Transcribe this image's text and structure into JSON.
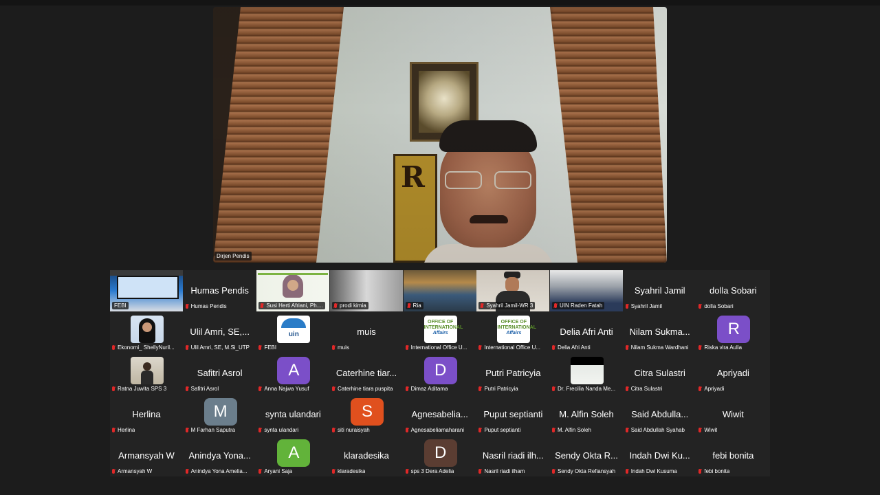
{
  "speaker": {
    "name": "Dirjen Pendis",
    "wall_letter": "R"
  },
  "colors": {
    "background": "#1c1c1c",
    "tile_bg": "#232323",
    "muted_mic": "#e02828",
    "avatar_purple": "#7b4fc8",
    "avatar_gray": "#6b7e8c",
    "avatar_green": "#62b33a",
    "avatar_orange": "#e0501e",
    "avatar_brown": "#5b3d32"
  },
  "participants": [
    {
      "big": "",
      "label": "FEBI",
      "kind": "video-blue",
      "muted": false
    },
    {
      "big": "Humas Pendis",
      "label": "Humas Pendis",
      "kind": "text",
      "muted": true
    },
    {
      "big": "",
      "label": "Susi Herti Afriani, Ph....",
      "kind": "video-woman",
      "muted": true
    },
    {
      "big": "",
      "label": "prodi kimia",
      "kind": "video-gray",
      "muted": true
    },
    {
      "big": "",
      "label": "Ria",
      "kind": "video-hall",
      "muted": true
    },
    {
      "big": "",
      "label": "Syahril Jamil-WR 3",
      "kind": "video-man",
      "muted": true
    },
    {
      "big": "",
      "label": "UIN Raden Fatah",
      "kind": "video-hall2",
      "muted": true
    },
    {
      "big": "Syahril Jamil",
      "label": "Syahril Jamil",
      "kind": "text",
      "muted": true
    },
    {
      "big": "dolla Sobari",
      "label": "dolla Sobari",
      "kind": "text",
      "muted": true
    },
    {
      "big": "",
      "label": "Ekonomi_ ShellyNuril...",
      "kind": "photo-hijab",
      "muted": true
    },
    {
      "big": "Ulil Amri, SE,...",
      "label": "Ulil Amri, SE, M.Si_UTP",
      "kind": "text",
      "muted": true
    },
    {
      "big": "",
      "label": "FEBI",
      "kind": "logo-uin",
      "muted": true
    },
    {
      "big": "muis",
      "label": "muis",
      "kind": "text",
      "muted": true
    },
    {
      "big": "",
      "label": "International Office U...",
      "kind": "logo-oia",
      "muted": true
    },
    {
      "big": "",
      "label": "International Office U...",
      "kind": "logo-oia",
      "muted": true
    },
    {
      "big": "Delia Afri Anti",
      "label": "Delia Afri Anti",
      "kind": "text",
      "muted": true
    },
    {
      "big": "Nilam Sukma...",
      "label": "Nilam Sukma Wardhani",
      "kind": "text",
      "muted": true
    },
    {
      "big": "",
      "label": "Riska vira Aulia",
      "kind": "avatar",
      "letter": "R",
      "color": "#7b4fc8",
      "muted": true
    },
    {
      "big": "",
      "label": "Ratna Juwita SPS 3",
      "kind": "photo-person",
      "muted": true
    },
    {
      "big": "Safitri Asrol",
      "label": "Safitri Asrol",
      "kind": "text",
      "muted": true
    },
    {
      "big": "",
      "label": "Anna Najwa Yusuf",
      "kind": "avatar",
      "letter": "A",
      "color": "#7b4fc8",
      "muted": true
    },
    {
      "big": "Caterhine tiar...",
      "label": "Caterhine tiara puspita",
      "kind": "text",
      "muted": true
    },
    {
      "big": "",
      "label": "Dimaz Aditama",
      "kind": "avatar",
      "letter": "D",
      "color": "#7b4fc8",
      "muted": true
    },
    {
      "big": "Putri Patricyia",
      "label": "Putri Patricyia",
      "kind": "text",
      "muted": true
    },
    {
      "big": "",
      "label": "Dr. Frecilia Nanda Me...",
      "kind": "photo-doc",
      "muted": true
    },
    {
      "big": "Citra Sulastri",
      "label": "Citra Sulastri",
      "kind": "text",
      "muted": true
    },
    {
      "big": "Apriyadi",
      "label": "Apriyadi",
      "kind": "text",
      "muted": true
    },
    {
      "big": "Herlina",
      "label": "Herlina",
      "kind": "text",
      "muted": true
    },
    {
      "big": "",
      "label": "M Farhan Saputra",
      "kind": "avatar",
      "letter": "M",
      "color": "#6b7e8c",
      "muted": true
    },
    {
      "big": "synta ulandari",
      "label": "synta ulandari",
      "kind": "text",
      "muted": true
    },
    {
      "big": "",
      "label": "siti nuraisyah",
      "kind": "avatar",
      "letter": "S",
      "color": "#e0501e",
      "muted": true
    },
    {
      "big": "Agnesabelia...",
      "label": "Agnesabeliamaharani",
      "kind": "text",
      "muted": true
    },
    {
      "big": "Puput septianti",
      "label": "Puput septianti",
      "kind": "text",
      "muted": true
    },
    {
      "big": "M. Alfin Soleh",
      "label": "M. Alfin Soleh",
      "kind": "text",
      "muted": true
    },
    {
      "big": "Said Abdulla...",
      "label": "Said Abdullah Syahab",
      "kind": "text",
      "muted": true
    },
    {
      "big": "Wiwit",
      "label": "Wiwit",
      "kind": "text",
      "muted": true
    },
    {
      "big": "Armansyah W",
      "label": "Armansyah W",
      "kind": "text",
      "muted": true
    },
    {
      "big": "Anindya Yona...",
      "label": "Anindya Yona Amelia...",
      "kind": "text",
      "muted": true
    },
    {
      "big": "",
      "label": "Aryani Saja",
      "kind": "avatar",
      "letter": "A",
      "color": "#62b33a",
      "muted": true
    },
    {
      "big": "klaradesika",
      "label": "klaradesika",
      "kind": "text",
      "muted": true
    },
    {
      "big": "",
      "label": "sps 3 Dera Adelia",
      "kind": "avatar",
      "letter": "D",
      "color": "#5b3d32",
      "muted": true
    },
    {
      "big": "Nasril riadi ilh...",
      "label": "Nasril riadi ilham",
      "kind": "text",
      "muted": true
    },
    {
      "big": "Sendy Okta R...",
      "label": "Sendy Okta Refiansyah",
      "kind": "text",
      "muted": true
    },
    {
      "big": "Indah Dwi Ku...",
      "label": "Indah Dwi Kusuma",
      "kind": "text",
      "muted": true
    },
    {
      "big": "febi bonita",
      "label": "febi bonita",
      "kind": "text",
      "muted": true
    }
  ]
}
